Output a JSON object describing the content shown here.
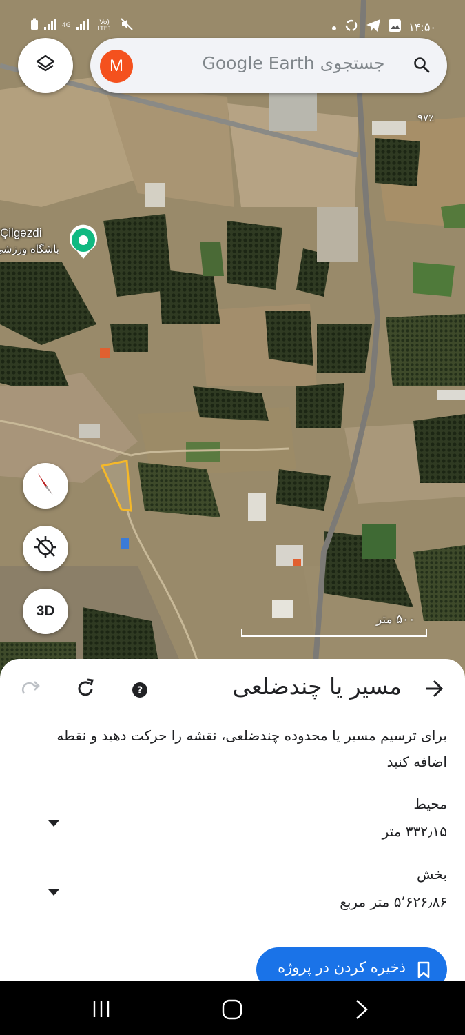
{
  "status_bar": {
    "time": "۱۴:۵۰",
    "network_left": "4G",
    "network_right": "Vo) LTE1",
    "icons": [
      "battery-icon",
      "signal-icon",
      "signal-icon",
      "mute-icon",
      "dot-icon",
      "sync-icon",
      "telegram-icon",
      "gallery-icon"
    ]
  },
  "search": {
    "avatar_letter": "M",
    "placeholder": "جستجوی Google Earth"
  },
  "map": {
    "zoom_level": "۹۷٪",
    "place_name": "Çilgəzdi",
    "place_subtitle": "باشگاه ورزشی",
    "scale_label": "۵۰۰ متر",
    "polygon_color": "#f5b829",
    "pin_color": "#10b981"
  },
  "map_buttons": {
    "three_d_label": "3D"
  },
  "sheet": {
    "title": "مسیر یا چندضلعی",
    "description": "برای ترسیم مسیر یا محدوده چندضلعی، نقشه را حرکت دهید و نقطه اضافه کنید",
    "perimeter_label": "محیط",
    "perimeter_value": "۳۳۲٫۱۵ متر",
    "area_label": "بخش",
    "area_value": "۵٬۶۲۶٫۸۶ متر مربع",
    "save_label": "ذخیره کردن در پروژه"
  },
  "colors": {
    "accent": "#1a73e8",
    "avatar": "#f4511e"
  }
}
